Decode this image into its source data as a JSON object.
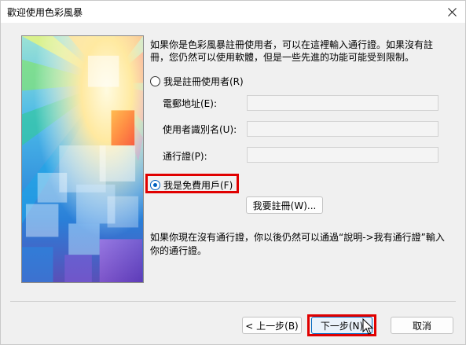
{
  "window": {
    "title": "歡迎使用色彩風暴",
    "close_label": "關閉"
  },
  "intro_text": "如果你是色彩風暴註冊使用者，可以在這裡輸入通行證。如果沒有註冊，您仍然可以使用軟體，但是一些先進的功能可能受到限制。",
  "registered_option": {
    "label": "我是註冊使用者(R)",
    "selected": false
  },
  "fields": {
    "email_label": "電郵地址(E):",
    "email_value": "",
    "username_label": "使用者識別名(U):",
    "username_value": "",
    "passport_label": "通行證(P):",
    "passport_value": ""
  },
  "free_option": {
    "label": "我是免費用戶(F)",
    "selected": true
  },
  "register_button_label": "我要註冊(W)...",
  "footer_text": "如果你現在沒有通行證，你以後仍然可以通過“說明->我有通行證”輸入你的通行證。",
  "buttons": {
    "back_label": "< 上一步(B)",
    "next_label": "下一步(N)",
    "cancel_label": "取消"
  },
  "colors": {
    "accent": "#0060c0",
    "highlight": "#e00000"
  }
}
